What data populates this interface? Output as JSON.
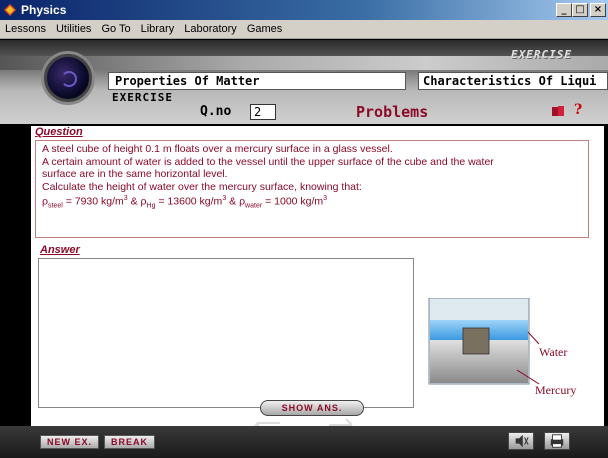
{
  "window": {
    "title": "Physics",
    "buttons": [
      "_",
      "□",
      "×"
    ]
  },
  "menu": [
    "Lessons",
    "Utilities",
    "Go To",
    "Library",
    "Laboratory",
    "Games"
  ],
  "header": {
    "logo_text": "EXERCISE",
    "topic": "Properties Of Matter",
    "subtopic": "Characteristics Of Liqui",
    "mode_label": "EXERCISE",
    "qno_label": "Q.no",
    "qno_value": "2",
    "section_title": "Problems"
  },
  "question": {
    "heading": "Question",
    "lines": [
      "A steel cube of height 0.1 m floats over a mercury surface in a glass vessel.",
      "A certain amount of water is added to the vessel until the upper surface of the cube and the water",
      "surface are in the same horizontal level.",
      "Calculate the height of water over the mercury surface, knowing that:"
    ],
    "densities": {
      "rho": "ρ",
      "steel_sub": "steel",
      "steel_val": " = 7930 kg/m",
      "hg_sub": "Hg",
      "hg_val": " = 13600 kg/m",
      "water_sub": "water",
      "water_val": " = 1000 kg/m",
      "exp": "3",
      "amp": " & "
    }
  },
  "answer": {
    "heading": "Answer",
    "text": ""
  },
  "diagram": {
    "water_label": "Water",
    "mercury_label": "Mercury"
  },
  "controls": {
    "show_answer": "SHOW ANS.",
    "new_ex": "NEW EX.",
    "break": "BREAK"
  },
  "colors": {
    "accent": "#8b0a2a",
    "water": "#4aa8e8",
    "mercury": "#b8b8b8"
  }
}
